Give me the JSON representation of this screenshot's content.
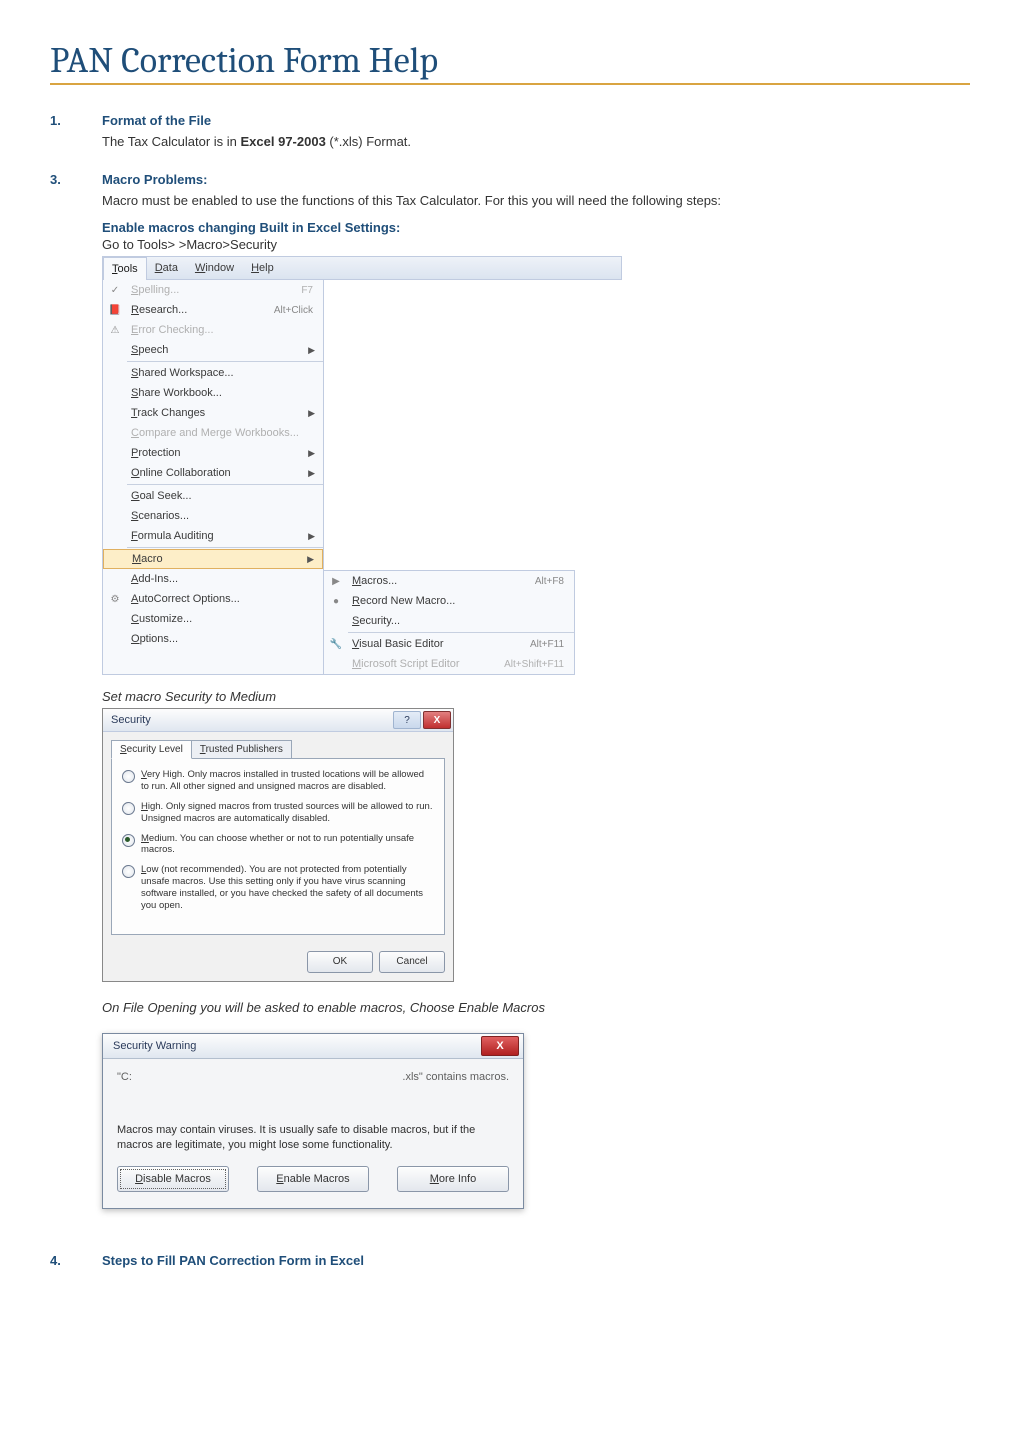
{
  "page": {
    "title": "PAN Correction Form Help"
  },
  "section1": {
    "num": "1.",
    "heading": "Format of the File",
    "body_prefix": "The Tax Calculator is in ",
    "body_bold": "Excel 97-2003",
    "body_suffix": " (*.xls) Format."
  },
  "section3": {
    "num": "3.",
    "heading": "Macro Problems:",
    "body": "Macro must be enabled to use the functions of this Tax Calculator. For this you will need the following steps:",
    "sub_heading": "Enable macros changing Built in Excel Settings:",
    "sub_body": "Go to Tools> >Macro>Security",
    "caption_medium": "Set macro Security to Medium",
    "caption_open": "On File Opening you will be asked to enable macros, Choose Enable Macros"
  },
  "section4": {
    "num": "4.",
    "heading": "Steps to Fill PAN Correction Form in Excel"
  },
  "tools_menu": {
    "tabs": [
      "Tools",
      "Data",
      "Window",
      "Help"
    ],
    "items": [
      {
        "label": "Spelling...",
        "shortcut": "F7",
        "disabled": true,
        "icon": "✓"
      },
      {
        "label": "Research...",
        "shortcut": "Alt+Click",
        "icon": "📕"
      },
      {
        "label": "Error Checking...",
        "disabled": true,
        "icon": "⚠"
      },
      {
        "label": "Speech",
        "submenu": true
      },
      {
        "sep": true
      },
      {
        "label": "Shared Workspace..."
      },
      {
        "label": "Share Workbook..."
      },
      {
        "label": "Track Changes",
        "submenu": true
      },
      {
        "label": "Compare and Merge Workbooks...",
        "disabled": true
      },
      {
        "label": "Protection",
        "submenu": true
      },
      {
        "label": "Online Collaboration",
        "submenu": true
      },
      {
        "sep": true
      },
      {
        "label": "Goal Seek..."
      },
      {
        "label": "Scenarios..."
      },
      {
        "label": "Formula Auditing",
        "submenu": true
      },
      {
        "sep": true
      },
      {
        "label": "Macro",
        "submenu": true,
        "highlight": true
      },
      {
        "label": "Add-Ins..."
      },
      {
        "label": "AutoCorrect Options...",
        "icon": "⚙"
      },
      {
        "label": "Customize..."
      },
      {
        "label": "Options..."
      }
    ],
    "submenu": [
      {
        "label": "Macros...",
        "shortcut": "Alt+F8",
        "icon": "▶"
      },
      {
        "label": "Record New Macro...",
        "icon": "●"
      },
      {
        "label": "Security..."
      },
      {
        "sep": true
      },
      {
        "label": "Visual Basic Editor",
        "shortcut": "Alt+F11",
        "icon": "🔧"
      },
      {
        "label": "Microsoft Script Editor",
        "shortcut": "Alt+Shift+F11",
        "disabled": true
      }
    ]
  },
  "security_dlg": {
    "title": "Security",
    "tab1": "Security Level",
    "tab2": "Trusted Publishers",
    "options": [
      {
        "u": "V",
        "rest": "ery High. Only macros installed in trusted locations will be allowed to run. All other signed and unsigned macros are disabled."
      },
      {
        "u": "H",
        "rest": "igh. Only signed macros from trusted sources will be allowed to run. Unsigned macros are automatically disabled."
      },
      {
        "u": "M",
        "rest": "edium. You can choose whether or not to run potentially unsafe macros.",
        "selected": true
      },
      {
        "u": "L",
        "rest": "ow (not recommended). You are not protected from potentially unsafe macros. Use this setting only if you have virus scanning software installed, or you have checked the safety of all documents you open."
      }
    ],
    "ok": "OK",
    "cancel": "Cancel"
  },
  "warn_dlg": {
    "title": "Security Warning",
    "path": "\"C:",
    "suffix": ".xls\" contains macros.",
    "msg": "Macros may contain viruses. It is usually safe to disable macros, but if the macros are legitimate, you might lose some functionality.",
    "disable": "Disable Macros",
    "enable": "Enable Macros",
    "more": "More Info"
  }
}
